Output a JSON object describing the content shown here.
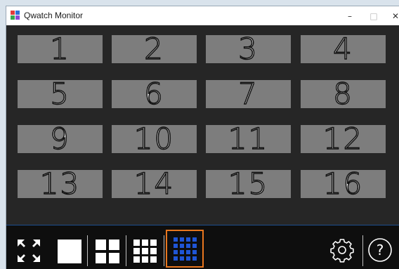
{
  "window": {
    "title": "Qwatch Monitor",
    "controls": {
      "minimize": "–",
      "maximize": "□",
      "close": "✕"
    }
  },
  "tiles": [
    "1",
    "2",
    "3",
    "4",
    "5",
    "6",
    "7",
    "8",
    "9",
    "10",
    "11",
    "12",
    "13",
    "14",
    "15",
    "16"
  ],
  "toolbar": {
    "layouts": [
      {
        "icon": "fullscreen-arrows-icon"
      },
      {
        "icon": "layout-1-icon"
      },
      {
        "icon": "layout-4-icon"
      },
      {
        "icon": "layout-9-icon"
      },
      {
        "icon": "layout-16-icon",
        "selected": true
      }
    ],
    "settings_icon": "gear-icon",
    "help_icon": "help-icon",
    "help_glyph": "?"
  },
  "colors": {
    "background": "#262626",
    "tile": "#7d7d7d",
    "toolbar": "#0e0e0e",
    "selected_frame": "#e8761e",
    "selected_dots": "#1f55d6"
  }
}
